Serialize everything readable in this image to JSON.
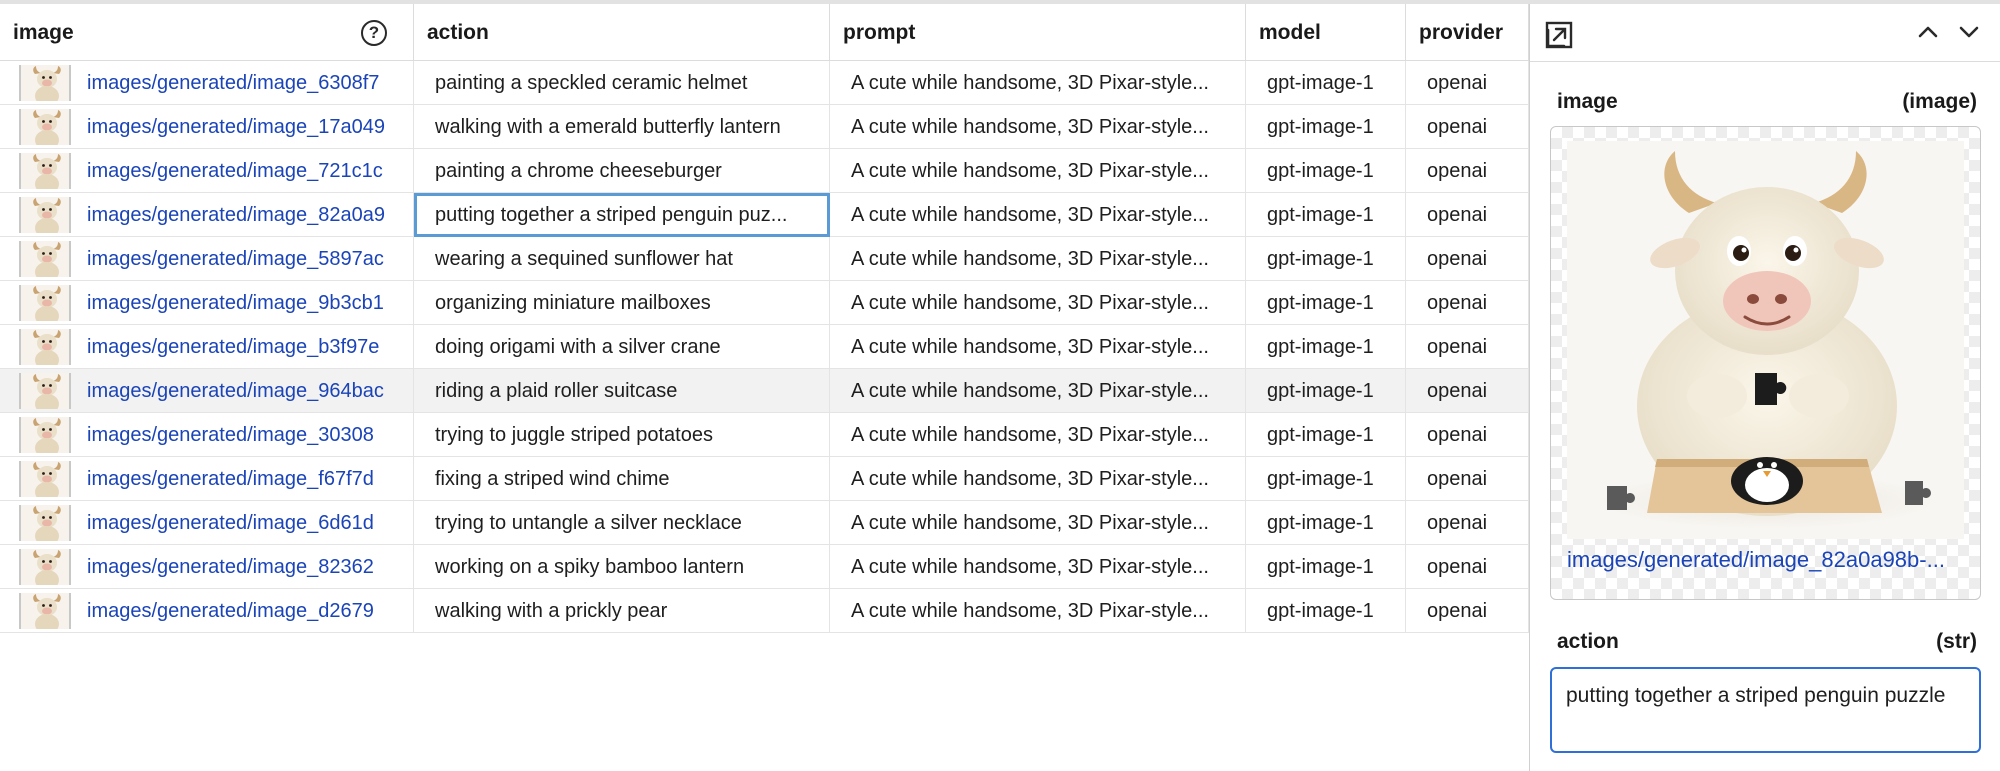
{
  "columns": {
    "image": "image",
    "action": "action",
    "prompt": "prompt",
    "model": "model",
    "provider": "provider"
  },
  "rows": [
    {
      "image": "images/generated/image_6308f7",
      "action": "painting a speckled ceramic helmet",
      "prompt": "A cute while handsome, 3D Pixar-style...",
      "model": "gpt-image-1",
      "provider": "openai"
    },
    {
      "image": "images/generated/image_17a049",
      "action": "walking with a emerald butterfly lantern",
      "prompt": "A cute while handsome, 3D Pixar-style...",
      "model": "gpt-image-1",
      "provider": "openai"
    },
    {
      "image": "images/generated/image_721c1c",
      "action": "painting a chrome cheeseburger",
      "prompt": "A cute while handsome, 3D Pixar-style...",
      "model": "gpt-image-1",
      "provider": "openai"
    },
    {
      "image": "images/generated/image_82a0a9",
      "action": "putting together a striped penguin puz...",
      "prompt": "A cute while handsome, 3D Pixar-style...",
      "model": "gpt-image-1",
      "provider": "openai"
    },
    {
      "image": "images/generated/image_5897ac",
      "action": "wearing a sequined sunflower hat",
      "prompt": "A cute while handsome, 3D Pixar-style...",
      "model": "gpt-image-1",
      "provider": "openai"
    },
    {
      "image": "images/generated/image_9b3cb1",
      "action": "organizing miniature mailboxes",
      "prompt": "A cute while handsome, 3D Pixar-style...",
      "model": "gpt-image-1",
      "provider": "openai"
    },
    {
      "image": "images/generated/image_b3f97e",
      "action": "doing origami with a silver crane",
      "prompt": "A cute while handsome, 3D Pixar-style...",
      "model": "gpt-image-1",
      "provider": "openai"
    },
    {
      "image": "images/generated/image_964bac",
      "action": "riding a plaid roller suitcase",
      "prompt": "A cute while handsome, 3D Pixar-style...",
      "model": "gpt-image-1",
      "provider": "openai"
    },
    {
      "image": "images/generated/image_30308",
      "action": "trying to juggle striped potatoes",
      "prompt": "A cute while handsome, 3D Pixar-style...",
      "model": "gpt-image-1",
      "provider": "openai"
    },
    {
      "image": "images/generated/image_f67f7d",
      "action": "fixing a striped wind chime",
      "prompt": "A cute while handsome, 3D Pixar-style...",
      "model": "gpt-image-1",
      "provider": "openai"
    },
    {
      "image": "images/generated/image_6d61d",
      "action": "trying to untangle a silver necklace",
      "prompt": "A cute while handsome, 3D Pixar-style...",
      "model": "gpt-image-1",
      "provider": "openai"
    },
    {
      "image": "images/generated/image_82362",
      "action": "working on a spiky bamboo lantern",
      "prompt": "A cute while handsome, 3D Pixar-style...",
      "model": "gpt-image-1",
      "provider": "openai"
    },
    {
      "image": "images/generated/image_d2679",
      "action": "walking with a prickly pear",
      "prompt": "A cute while handsome, 3D Pixar-style...",
      "model": "gpt-image-1",
      "provider": "openai"
    }
  ],
  "selected_row": 3,
  "highlighted_row": 7,
  "panel": {
    "image_label": "image",
    "image_type": "(image)",
    "image_path": "images/generated/image_82a0a98b-...",
    "action_label": "action",
    "action_type": "(str)",
    "action_value": "putting together a striped penguin puzzle"
  },
  "icons": {
    "help": "help-circle-icon",
    "open": "open-external-icon",
    "up": "chevron-up-icon",
    "down": "chevron-down-icon"
  },
  "colors": {
    "link": "#1a44b8",
    "selection_border": "#5b9bd5",
    "input_focus": "#2f6fd8",
    "row_highlight": "#f2f2f2"
  }
}
